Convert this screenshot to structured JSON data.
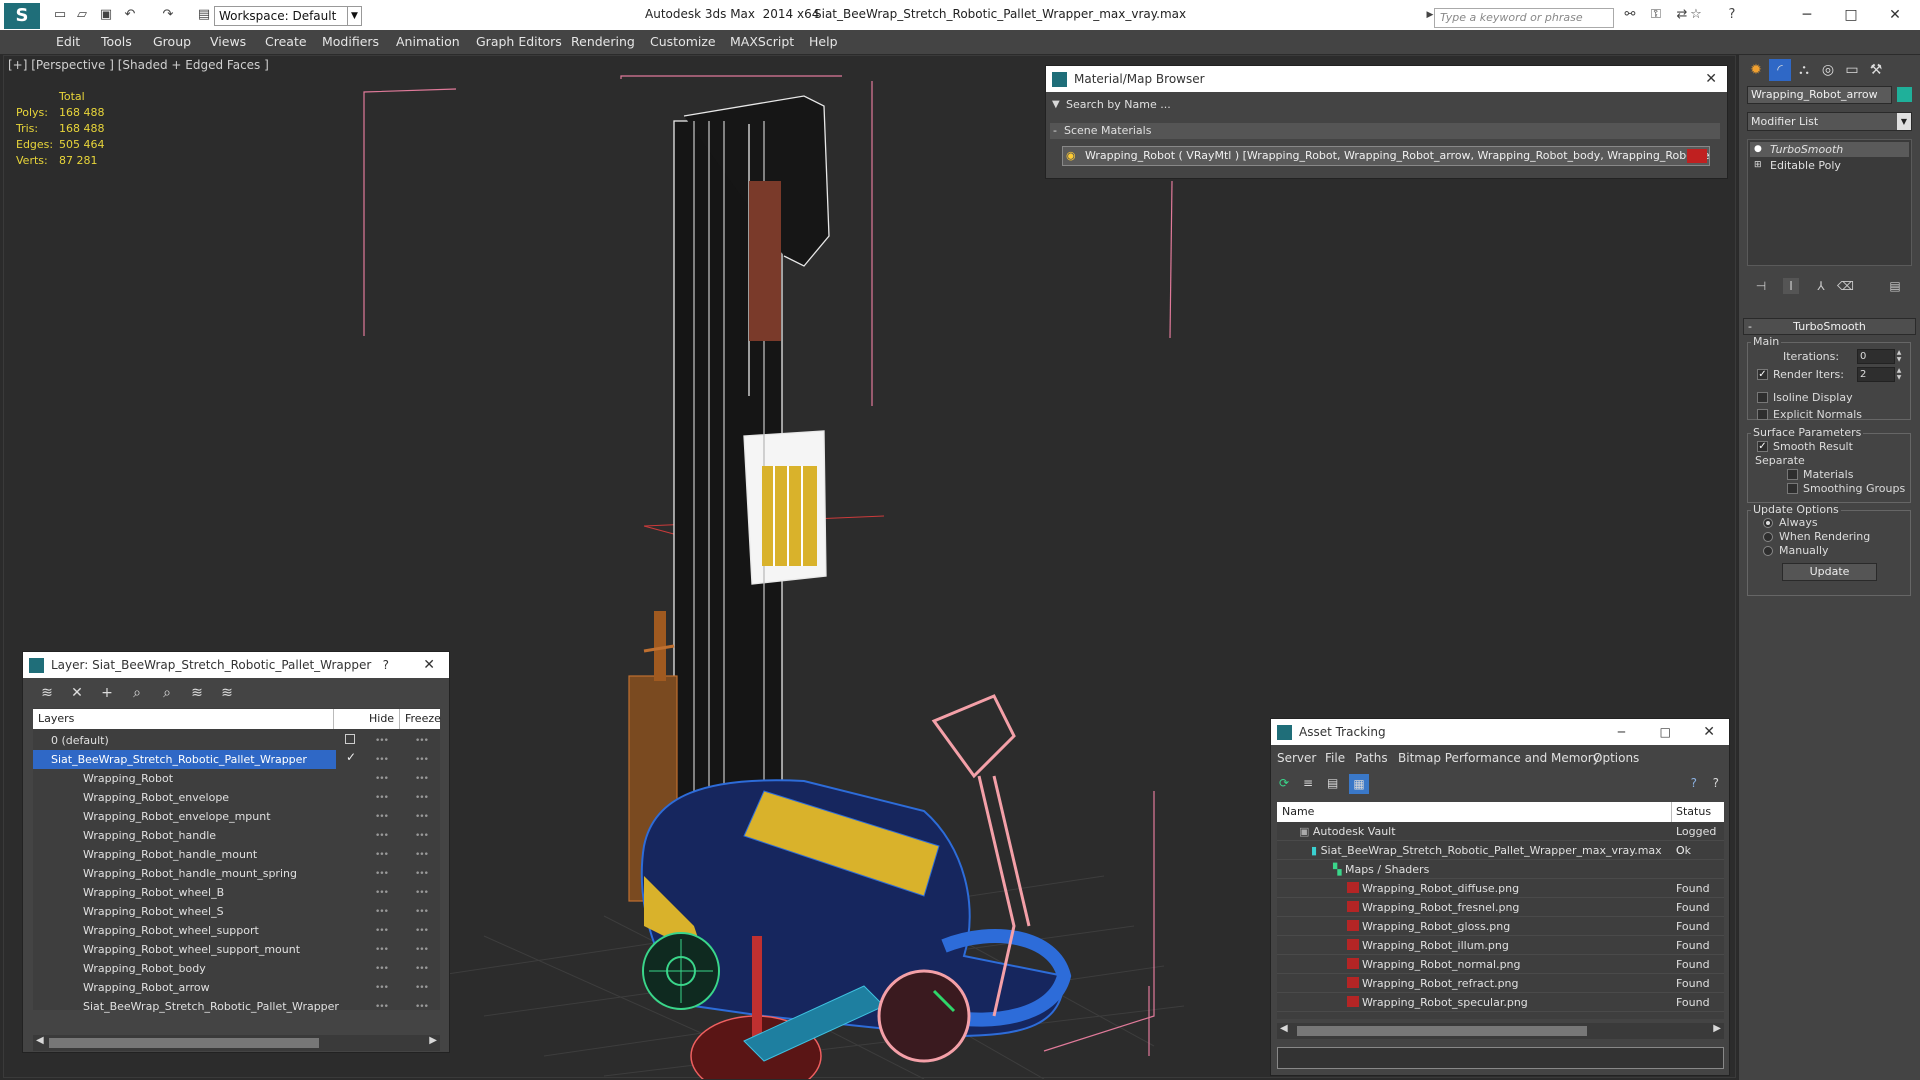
{
  "titlebar": {
    "workspace": "Workspace: Default",
    "app_title": "Autodesk 3ds Max  2014 x64",
    "doc_title": "Siat_BeeWrap_Stretch_Robotic_Pallet_Wrapper_max_vray.max",
    "search_placeholder": "Type a keyword or phrase"
  },
  "menu": [
    "Edit",
    "Tools",
    "Group",
    "Views",
    "Create",
    "Modifiers",
    "Animation",
    "Graph Editors",
    "Rendering",
    "Customize",
    "MAXScript",
    "Help"
  ],
  "viewport": {
    "label": "[+] [Perspective ] [Shaded + Edged Faces ]",
    "stats": {
      "header": "Total",
      "rows": [
        {
          "k": "Polys:",
          "v": "168 488"
        },
        {
          "k": "Tris:",
          "v": "168 488"
        },
        {
          "k": "Edges:",
          "v": "505 464"
        },
        {
          "k": "Verts:",
          "v": "87 281"
        }
      ]
    }
  },
  "material_browser": {
    "title": "Material/Map Browser",
    "search": "Search by Name ...",
    "section": "Scene Materials",
    "material": "Wrapping_Robot ( VRayMtl ) [Wrapping_Robot, Wrapping_Robot_arrow, Wrapping_Robot_body, Wrapping_Robot_enve..."
  },
  "layer_panel": {
    "title": "Layer: Siat_BeeWrap_Stretch_Robotic_Pallet_Wrapper",
    "col_layers": "Layers",
    "col_hide": "Hide",
    "col_freeze": "Freeze",
    "rows": [
      {
        "label": "0 (default)"
      },
      {
        "label": "Siat_BeeWrap_Stretch_Robotic_Pallet_Wrapper"
      },
      {
        "label": "Wrapping_Robot"
      },
      {
        "label": "Wrapping_Robot_envelope"
      },
      {
        "label": "Wrapping_Robot_envelope_mpunt"
      },
      {
        "label": "Wrapping_Robot_handle"
      },
      {
        "label": "Wrapping_Robot_handle_mount"
      },
      {
        "label": "Wrapping_Robot_handle_mount_spring"
      },
      {
        "label": "Wrapping_Robot_wheel_B"
      },
      {
        "label": "Wrapping_Robot_wheel_S"
      },
      {
        "label": "Wrapping_Robot_wheel_support"
      },
      {
        "label": "Wrapping_Robot_wheel_support_mount"
      },
      {
        "label": "Wrapping_Robot_body"
      },
      {
        "label": "Wrapping_Robot_arrow"
      },
      {
        "label": "Siat_BeeWrap_Stretch_Robotic_Pallet_Wrapper"
      }
    ]
  },
  "asset_tracking": {
    "title": "Asset Tracking",
    "menu": [
      "Server",
      "File",
      "Paths",
      "Bitmap Performance and Memory",
      "Options"
    ],
    "col_name": "Name",
    "col_status": "Status",
    "rows": [
      {
        "name": "Autodesk Vault",
        "status": "Logged O"
      },
      {
        "name": "Siat_BeeWrap_Stretch_Robotic_Pallet_Wrapper_max_vray.max",
        "status": "Ok"
      },
      {
        "name": "Maps / Shaders",
        "status": ""
      },
      {
        "name": "Wrapping_Robot_diffuse.png",
        "status": "Found"
      },
      {
        "name": "Wrapping_Robot_fresnel.png",
        "status": "Found"
      },
      {
        "name": "Wrapping_Robot_gloss.png",
        "status": "Found"
      },
      {
        "name": "Wrapping_Robot_illum.png",
        "status": "Found"
      },
      {
        "name": "Wrapping_Robot_normal.png",
        "status": "Found"
      },
      {
        "name": "Wrapping_Robot_refract.png",
        "status": "Found"
      },
      {
        "name": "Wrapping_Robot_specular.png",
        "status": "Found"
      }
    ]
  },
  "command_panel": {
    "object_name": "Wrapping_Robot_arrow",
    "object_color": "#1fb09a",
    "modifier_list": "Modifier List",
    "stack": [
      "TurboSmooth",
      "Editable Poly"
    ],
    "rollout_title": "TurboSmooth",
    "main_label": "Main",
    "iterations_label": "Iterations:",
    "iterations_value": "0",
    "render_iters_label": "Render Iters:",
    "render_iters_value": "2",
    "isoline": "Isoline Display",
    "explicit_normals": "Explicit Normals",
    "surface_params": "Surface Parameters",
    "smooth_result": "Smooth Result",
    "separate": "Separate",
    "materials": "Materials",
    "smoothing_groups": "Smoothing Groups",
    "update_options": "Update Options",
    "always": "Always",
    "when_rendering": "When Rendering",
    "manually": "Manually",
    "update_button": "Update"
  }
}
